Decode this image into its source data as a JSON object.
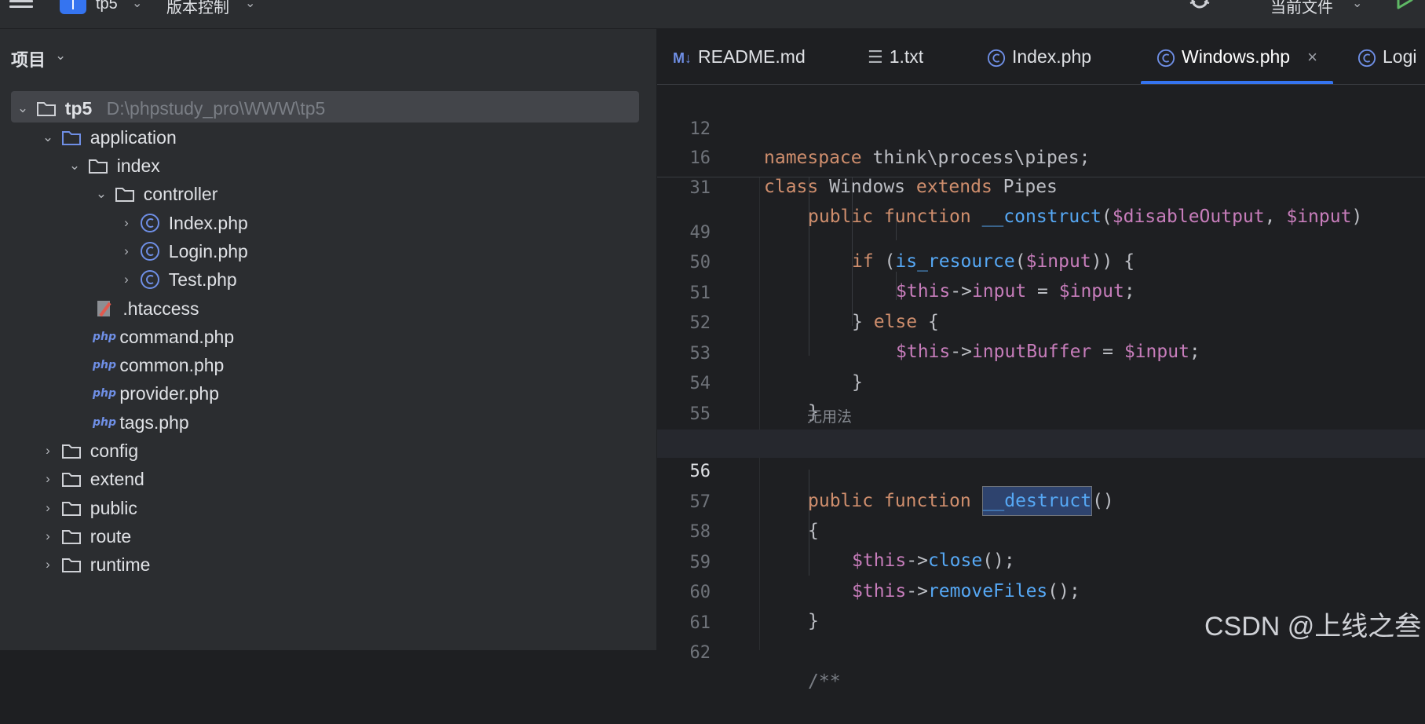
{
  "topbar": {
    "project_badge": "T",
    "project_name": "tp5",
    "vcs_label": "版本控制",
    "current_file_label": "当前文件"
  },
  "project_panel": {
    "title": "项目",
    "tree": {
      "root": {
        "name": "tp5",
        "path": "D:\\phpstudy_pro\\WWW\\tp5"
      },
      "application": "application",
      "index": "index",
      "controller": "controller",
      "index_php": "Index.php",
      "login_php": "Login.php",
      "test_php": "Test.php",
      "htaccess": ".htaccess",
      "command_php": "command.php",
      "common_php": "common.php",
      "provider_php": "provider.php",
      "tags_php": "tags.php",
      "config": "config",
      "extend": "extend",
      "public": "public",
      "route": "route",
      "runtime": "runtime"
    },
    "php_icon_text": "php"
  },
  "tabs": [
    {
      "label": "README.md",
      "icon": "markdown-icon",
      "icon_text": "M↓"
    },
    {
      "label": "1.txt",
      "icon": "text-file-icon"
    },
    {
      "label": "Index.php",
      "icon": "php-class-icon"
    },
    {
      "label": "Windows.php",
      "icon": "php-class-icon",
      "active": true
    },
    {
      "label": "Logi",
      "icon": "php-class-icon"
    }
  ],
  "editor": {
    "sticky_lines": [
      {
        "num": "12",
        "text": "namespace think\\process\\pipes;"
      },
      {
        "num": "16",
        "text": "class Windows extends Pipes"
      },
      {
        "num": "31",
        "text": "public function __construct($disableOutput, $input)"
      }
    ],
    "lines": [
      {
        "num": "49",
        "text": "if (is_resource($input)) {"
      },
      {
        "num": "50",
        "text": "$this->input = $input;"
      },
      {
        "num": "51",
        "text": "} else {"
      },
      {
        "num": "52",
        "text": "$this->inputBuffer = $input;"
      },
      {
        "num": "53",
        "text": "}"
      },
      {
        "num": "54",
        "text": "}"
      },
      {
        "num": "55",
        "text": ""
      },
      {
        "num": "56",
        "text": "public function __destruct()"
      },
      {
        "num": "57",
        "text": "{"
      },
      {
        "num": "58",
        "text": "$this->close();"
      },
      {
        "num": "59",
        "text": "$this->removeFiles();"
      },
      {
        "num": "60",
        "text": "}"
      },
      {
        "num": "61",
        "text": ""
      },
      {
        "num": "62",
        "text": "/**"
      }
    ],
    "inlay_hint": "无用法",
    "current_line": "56"
  },
  "watermark": "CSDN @上线之叁",
  "colors": {
    "accent": "#3574f0",
    "keyword": "#cf8e6d",
    "function": "#56a8f5",
    "variable": "#c77dbb"
  }
}
